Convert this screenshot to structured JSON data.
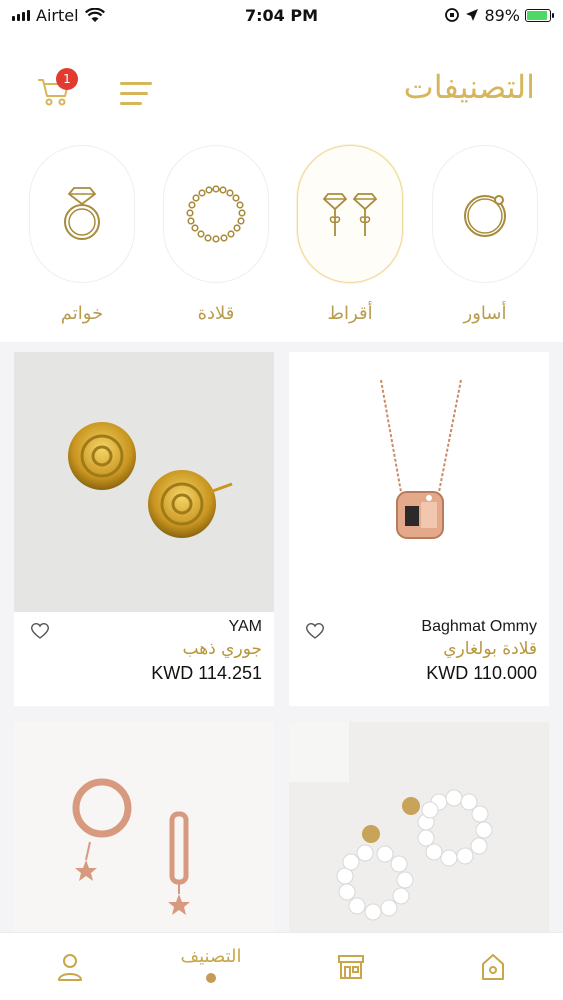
{
  "status_bar": {
    "carrier": "Airtel",
    "time": "7:04 PM",
    "battery": "89%"
  },
  "header": {
    "title": "التصنيفات",
    "cart_count": "1"
  },
  "categories": [
    {
      "label": "أساور",
      "icon": "bracelet-icon"
    },
    {
      "label": "أقراط",
      "icon": "earrings-icon"
    },
    {
      "label": "قلادة",
      "icon": "necklace-icon"
    },
    {
      "label": "خواتم",
      "icon": "ring-icon"
    }
  ],
  "active_category": "أقراط",
  "products": [
    {
      "brand": "Baghmat Ommy",
      "name": "قلادة بولغاري",
      "price": "KWD 110.000"
    },
    {
      "brand": "YAM",
      "name": "جوري ذهب",
      "price": "KWD 114.251"
    },
    {
      "brand": "",
      "name": "",
      "price": ""
    },
    {
      "brand": "",
      "name": "",
      "price": ""
    }
  ],
  "tabbar": {
    "active_label": "التصنيف",
    "tabs": [
      "home-icon",
      "store-icon",
      "categories-tab",
      "profile-icon"
    ]
  },
  "colors": {
    "accent_gold": "#d7b55a",
    "badge_red": "#e23a2f",
    "battery_green": "#4cd964"
  }
}
